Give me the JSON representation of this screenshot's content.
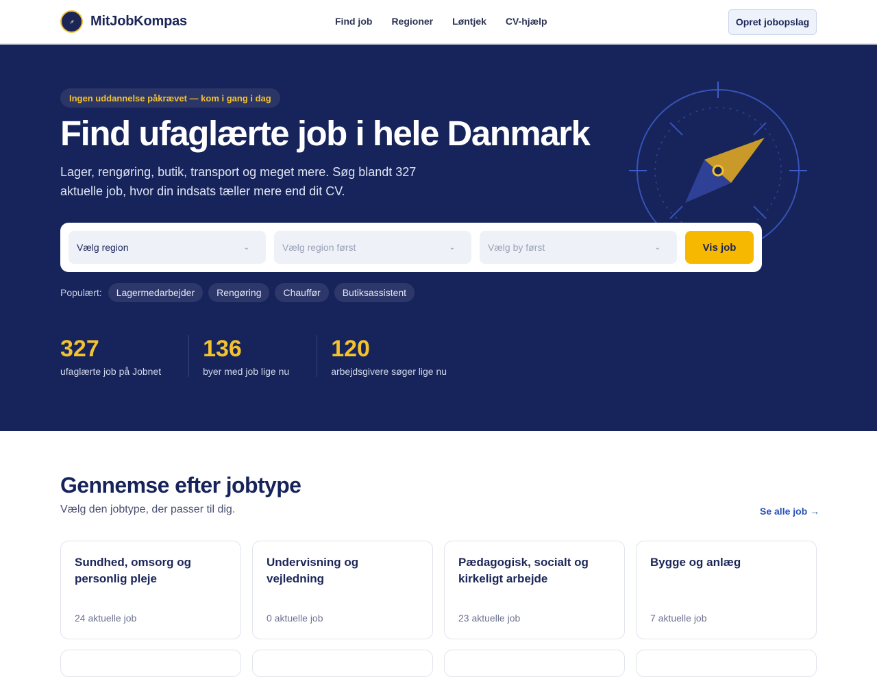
{
  "header": {
    "brand": "MitJobKompas",
    "nav": [
      "Find job",
      "Regioner",
      "Løntjek",
      "CV-hjælp"
    ],
    "cta": "Opret jobopslag"
  },
  "hero": {
    "badge": "Ingen uddannelse påkrævet — kom i gang i dag",
    "title": "Find ufaglærte job i hele Danmark",
    "lead": "Lager, rengøring, butik, transport og meget mere. Søg blandt 327 aktuelle job, hvor din indsats tæller mere end dit CV.",
    "search": {
      "region": "Vælg region",
      "city": "Vælg region først",
      "job": "Vælg by først",
      "button": "Vis job"
    },
    "popular_label": "Populært:",
    "popular": [
      "Lagermedarbejder",
      "Rengøring",
      "Chauffør",
      "Butiksassistent"
    ],
    "stats": [
      {
        "value": "327",
        "label": "ufaglærte job på Jobnet"
      },
      {
        "value": "136",
        "label": "byer med job lige nu"
      },
      {
        "value": "120",
        "label": "arbejdsgivere søger lige nu"
      }
    ]
  },
  "categories": {
    "title": "Gennemse efter jobtype",
    "subtitle": "Vælg den jobtype, der passer til dig.",
    "see_all": "Se alle job →",
    "items": [
      {
        "name": "Sundhed, omsorg og personlig pleje",
        "count": "24 aktuelle job"
      },
      {
        "name": "Undervisning og vejledning",
        "count": "0 aktuelle job"
      },
      {
        "name": "Pædagogisk, socialt og kirkeligt arbejde",
        "count": "23 aktuelle job"
      },
      {
        "name": "Bygge og anlæg",
        "count": "7 aktuelle job"
      }
    ]
  },
  "colors": {
    "navy": "#17245b",
    "accent": "#f3c22f",
    "button": "#f6b800"
  },
  "icons": [
    "compass-icon",
    "chevron-down-icon"
  ]
}
